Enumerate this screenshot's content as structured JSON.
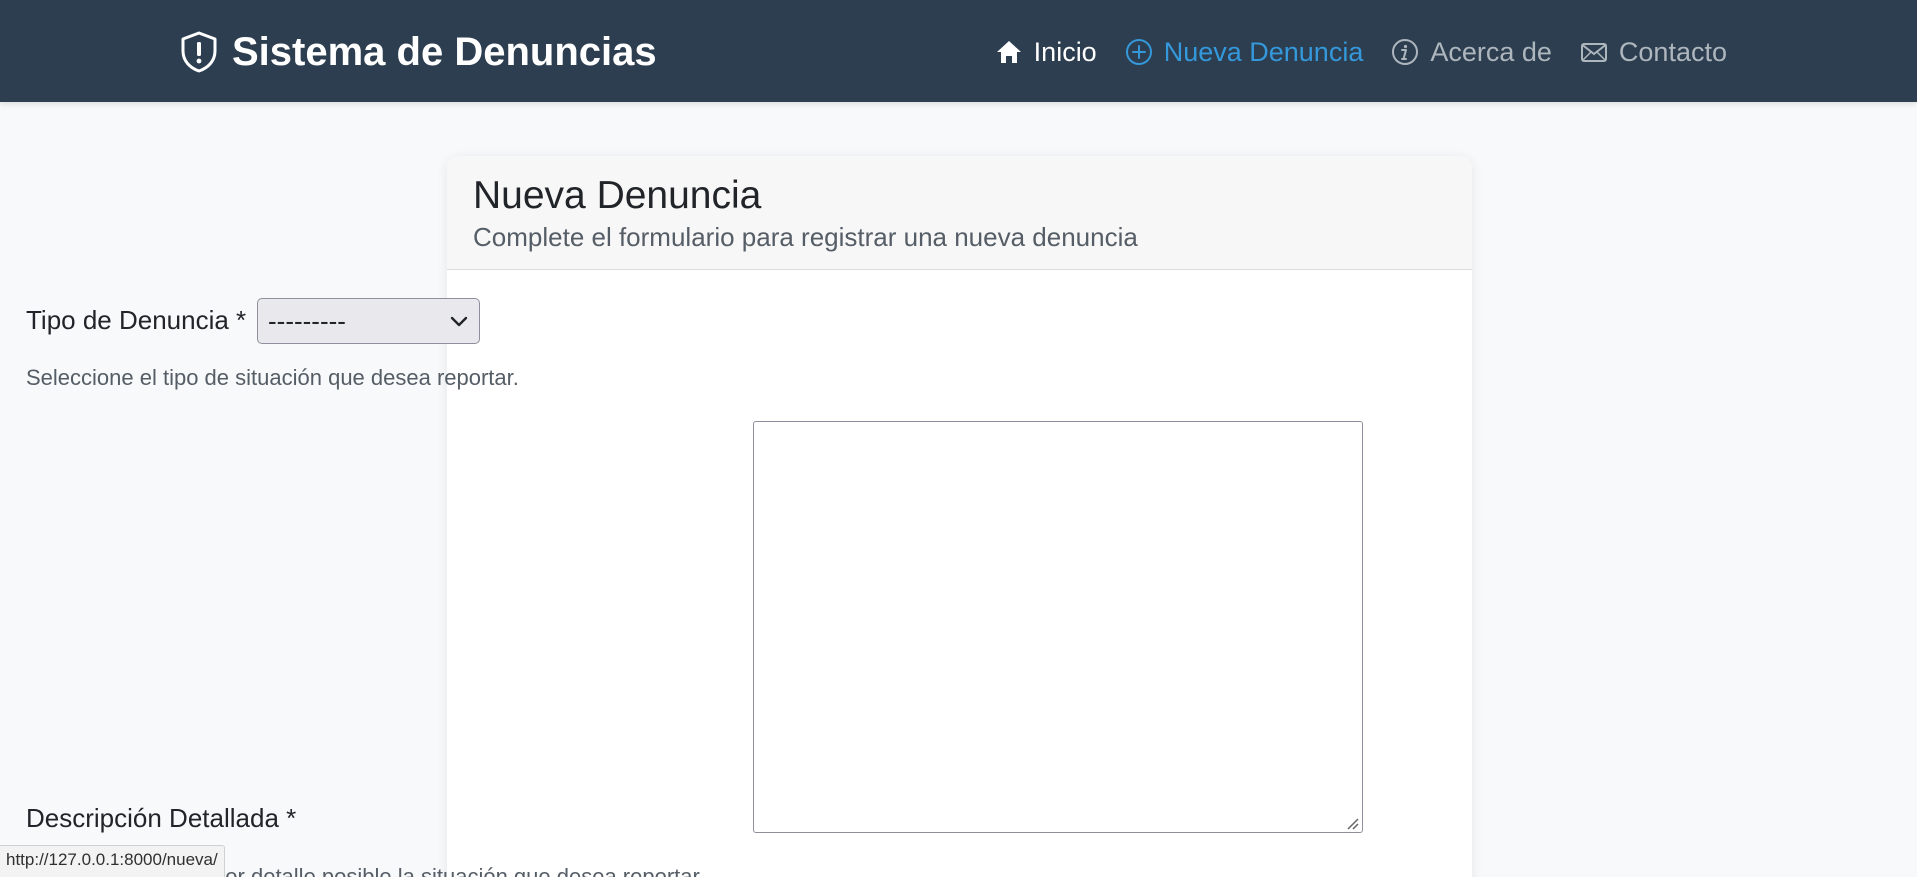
{
  "navbar": {
    "brand": "Sistema de Denuncias",
    "brand_icon": "shield-exclamation-icon",
    "items": [
      {
        "label": "Inicio",
        "icon": "house-icon"
      },
      {
        "label": "Nueva Denuncia",
        "icon": "plus-circle-icon",
        "active": true
      },
      {
        "label": "Acerca de",
        "icon": "info-circle-icon"
      },
      {
        "label": "Contacto",
        "icon": "envelope-icon"
      }
    ]
  },
  "form": {
    "title": "Nueva Denuncia",
    "subtitle": "Complete el formulario para registrar una nueva denuncia",
    "tipo_label": "Tipo de Denuncia *",
    "tipo_selected": "---------",
    "tipo_help": "Seleccione el tipo de situación que desea reportar.",
    "descripcion_label": "Descripción Detallada *",
    "descripcion_value": "",
    "descripcion_help": "Describa con el mayor detalle posible la situación que desea reportar."
  },
  "status_bar": {
    "url": "http://127.0.0.1:8000/nueva/"
  },
  "colors": {
    "navbar_bg": "#2c3e50",
    "active_link": "#3498db",
    "page_bg": "#f8f9fa"
  }
}
